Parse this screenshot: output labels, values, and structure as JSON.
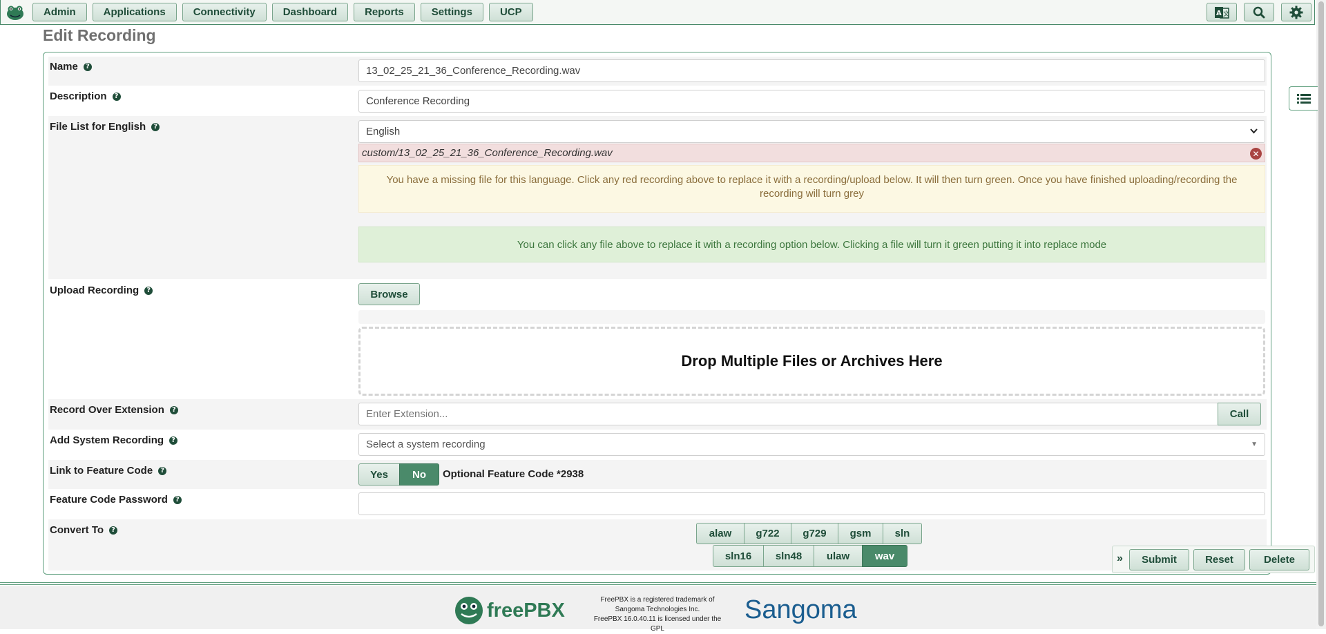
{
  "nav": {
    "items": [
      "Admin",
      "Applications",
      "Connectivity",
      "Dashboard",
      "Reports",
      "Settings",
      "UCP"
    ],
    "right_icons": [
      "language-icon",
      "search-icon",
      "gear-icon"
    ]
  },
  "page": {
    "title": "Edit Recording"
  },
  "form": {
    "name": {
      "label": "Name",
      "value": "13_02_25_21_36_Conference_Recording.wav"
    },
    "description": {
      "label": "Description",
      "value": "Conference Recording"
    },
    "file_list": {
      "label": "File List for English",
      "selected_language": "English",
      "missing_file": "custom/13_02_25_21_36_Conference_Recording.wav",
      "warning": "You have a missing file for this language. Click any red recording above to replace it with a recording/upload below. It will then turn green. Once you have finished uploading/recording the recording will turn grey",
      "info": "You can click any file above to replace it with a recording option below. Clicking a file will turn it green putting it into replace mode"
    },
    "upload": {
      "label": "Upload Recording",
      "browse": "Browse",
      "dropzone": "Drop Multiple Files or Archives Here"
    },
    "record_over": {
      "label": "Record Over Extension",
      "placeholder": "Enter Extension...",
      "call": "Call"
    },
    "system_recording": {
      "label": "Add System Recording",
      "placeholder": "Select a system recording"
    },
    "feature_code": {
      "label": "Link to Feature Code",
      "yes": "Yes",
      "no": "No",
      "selected": "No",
      "optional_text": "Optional Feature Code *2938"
    },
    "feature_password": {
      "label": "Feature Code Password",
      "value": ""
    },
    "convert_to": {
      "label": "Convert To",
      "row1": [
        "alaw",
        "g722",
        "g729",
        "gsm",
        "sln"
      ],
      "row2": [
        "sln16",
        "sln48",
        "ulaw",
        "wav"
      ],
      "selected": [
        "wav"
      ]
    }
  },
  "actions": {
    "expand": "»",
    "submit": "Submit",
    "reset": "Reset",
    "delete": "Delete"
  },
  "footer": {
    "brand_left": "freePBX",
    "text_lines": [
      "FreePBX is a registered trademark of",
      "Sangoma Technologies Inc.",
      "FreePBX 16.0.40.11 is licensed under the",
      "GPL"
    ],
    "brand_right": "Sangoma"
  },
  "colors": {
    "accent": "#4a8a6a",
    "brand_dark": "#1f4d39",
    "danger": "#a94442",
    "warning_bg": "#fcf8e3",
    "success_bg": "#dff0d8"
  }
}
